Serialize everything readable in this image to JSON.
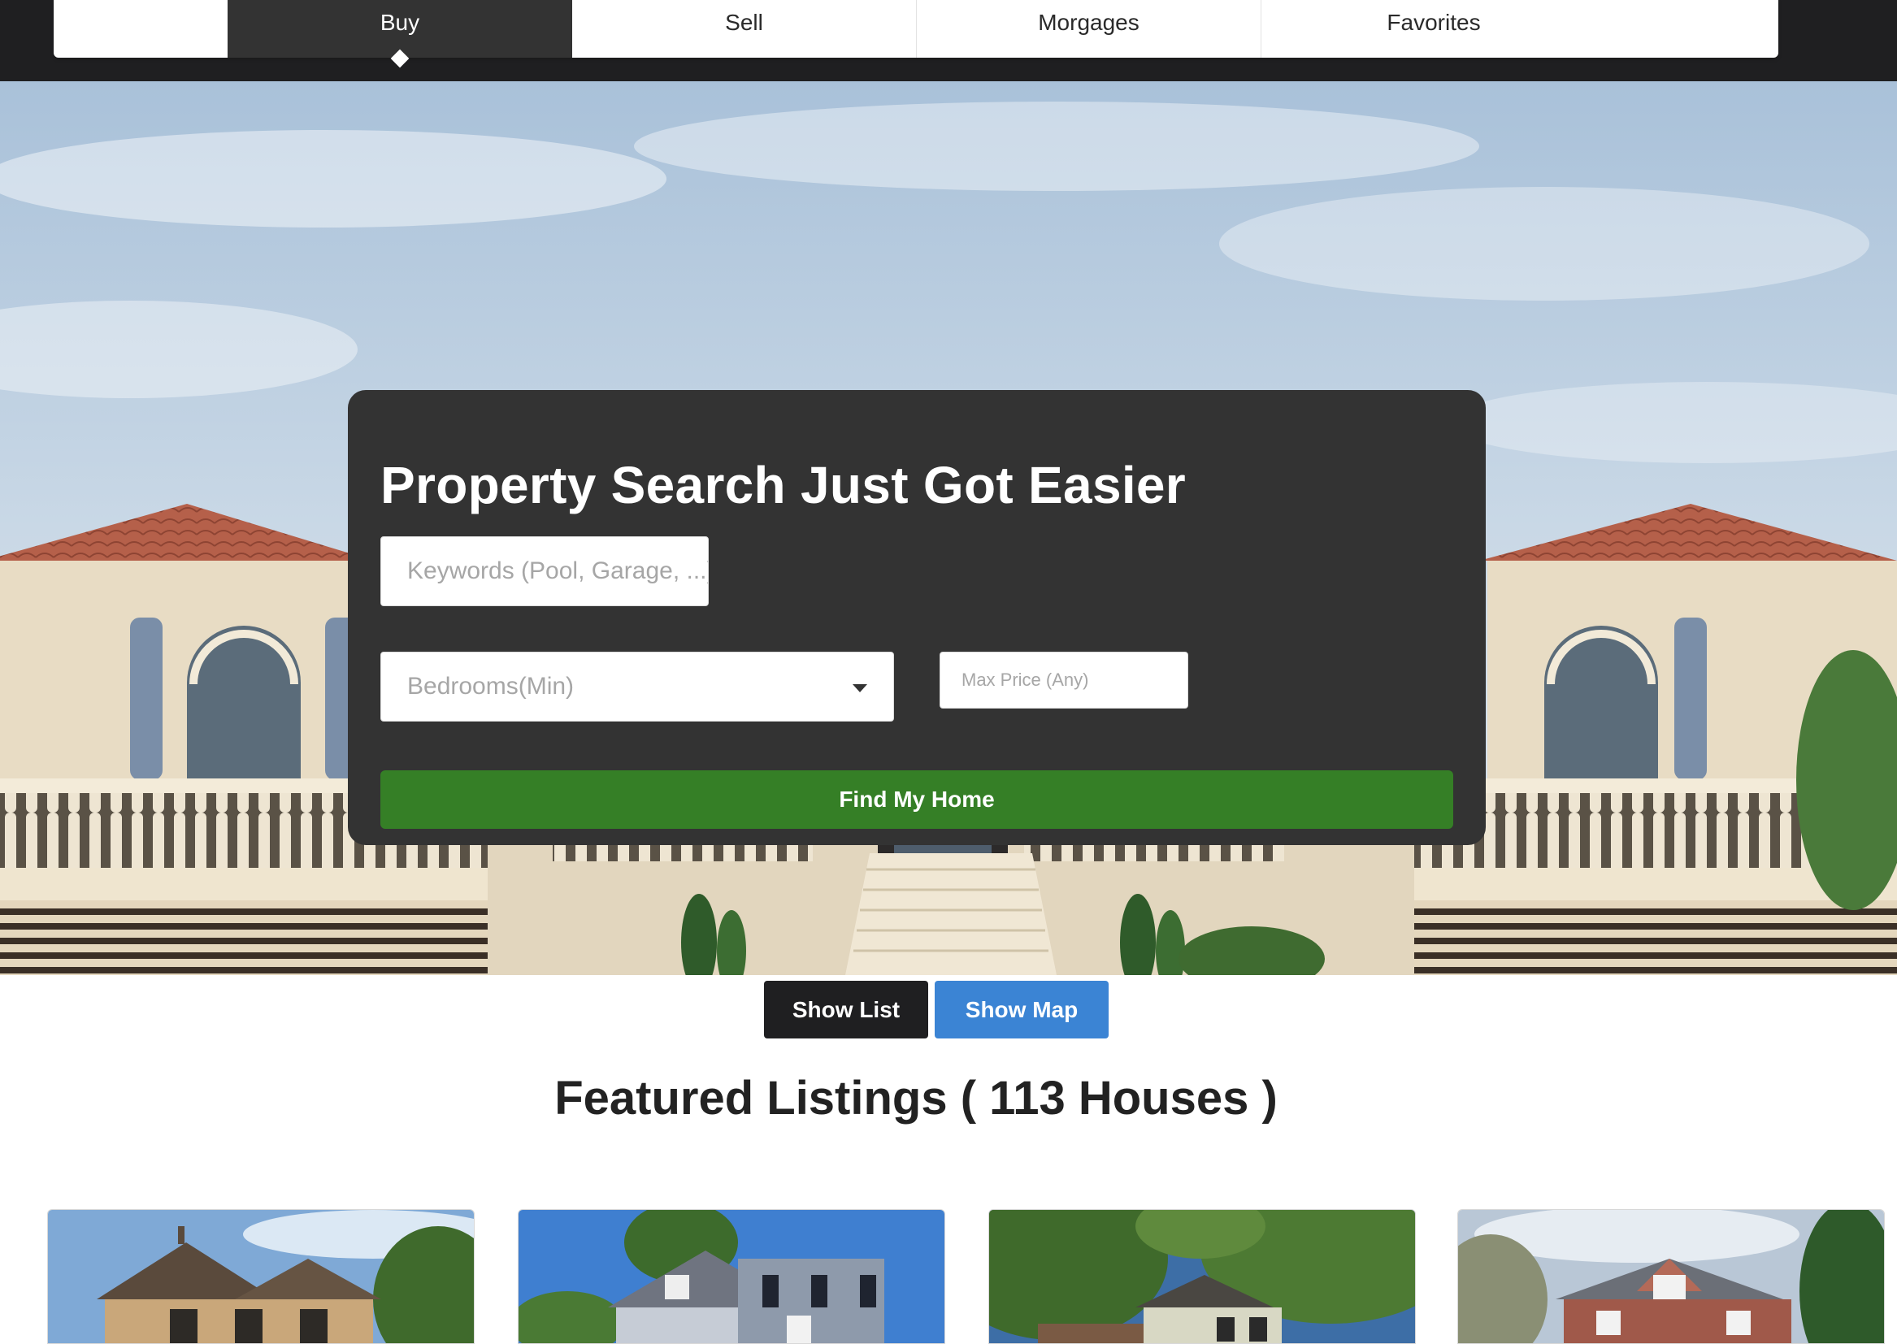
{
  "nav": {
    "tabs": [
      {
        "label": "Buy",
        "active": true
      },
      {
        "label": "Sell",
        "active": false
      },
      {
        "label": "Morgages",
        "active": false
      },
      {
        "label": "Favorites",
        "active": false
      }
    ]
  },
  "search": {
    "title": "Property Search Just Got Easier",
    "keywords_placeholder": "Keywords (Pool, Garage, ...)",
    "bedrooms_placeholder": "Bedrooms(Min)",
    "max_price_placeholder": "Max Price (Any)",
    "submit_label": "Find My Home"
  },
  "view_toggle": {
    "list_label": "Show List",
    "map_label": "Show Map"
  },
  "listings": {
    "heading": "Featured Listings ( 113 Houses )",
    "cards": [
      {
        "image": "house-photo-1"
      },
      {
        "image": "house-photo-2"
      },
      {
        "image": "house-photo-3"
      },
      {
        "image": "house-photo-4"
      }
    ]
  },
  "colors": {
    "nav_background": "#1f1f21",
    "panel_background": "#333333",
    "find_button": "#357f26",
    "show_list_button": "#1f1f21",
    "show_map_button": "#3b84d4"
  }
}
